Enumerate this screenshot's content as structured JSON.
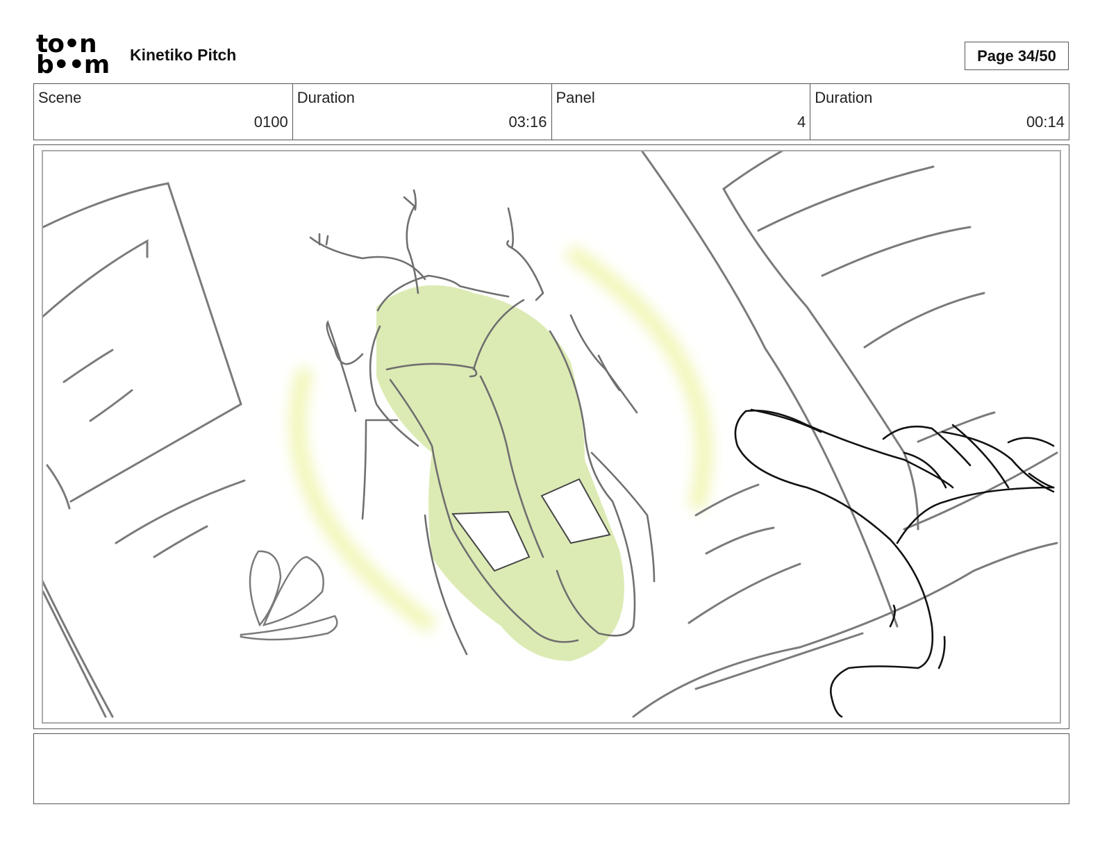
{
  "header": {
    "logo_line1": "to•n",
    "logo_line2": "b••m",
    "project_title": "Kinetiko Pitch",
    "page_indicator": "Page 34/50"
  },
  "info": [
    {
      "label": "Scene",
      "value": "0100"
    },
    {
      "label": "Duration",
      "value": "03:16"
    },
    {
      "label": "Panel",
      "value": "4"
    },
    {
      "label": "Duration",
      "value": "00:14"
    }
  ],
  "notes": {
    "text": ""
  },
  "colors": {
    "sketch_line": "#7a7a7a",
    "hand_line": "#111111",
    "fill_green": "#dcebb4",
    "glow_yellow": "#f1f5b0"
  }
}
